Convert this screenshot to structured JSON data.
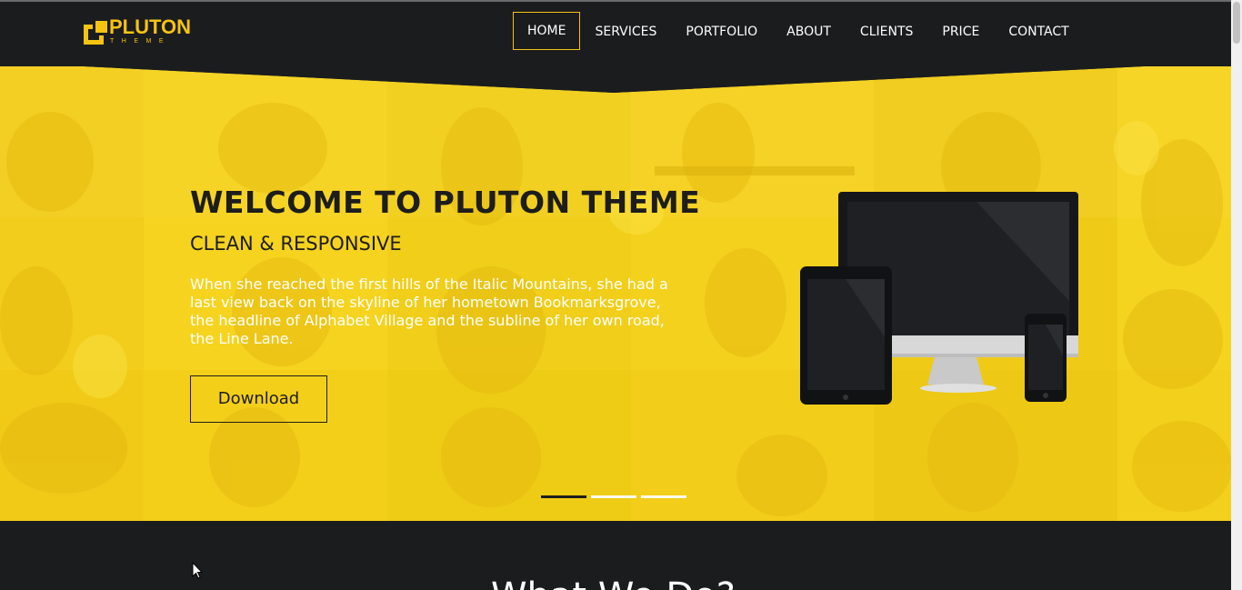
{
  "header": {
    "logo": {
      "word": "PLUTON",
      "sub": "THEME",
      "brand_color": "#f5c312"
    },
    "nav": {
      "items": [
        {
          "label": "HOME",
          "active": true
        },
        {
          "label": "SERVICES",
          "active": false
        },
        {
          "label": "PORTFOLIO",
          "active": false
        },
        {
          "label": "ABOUT",
          "active": false
        },
        {
          "label": "CLIENTS",
          "active": false
        },
        {
          "label": "PRICE",
          "active": false
        },
        {
          "label": "CONTACT",
          "active": false
        }
      ]
    }
  },
  "hero": {
    "title": "WELCOME TO PLUTON THEME",
    "subtitle": "CLEAN & RESPONSIVE",
    "text": "When she reached the first hills of the Italic Mountains, she had a last view back on the skyline of her hometown Bookmarksgrove, the headline of Alphabet Village and the subline of her own road, the Line Lane.",
    "button_label": "Download",
    "accent_color": "#f7d21b",
    "slides_total": 3,
    "slide_active": 1
  },
  "next_section": {
    "title": "What We Do?"
  },
  "icons": {
    "logo": "pluton-logo-icon",
    "devices": "devices-illustration",
    "cursor": "mouse-cursor-icon"
  }
}
